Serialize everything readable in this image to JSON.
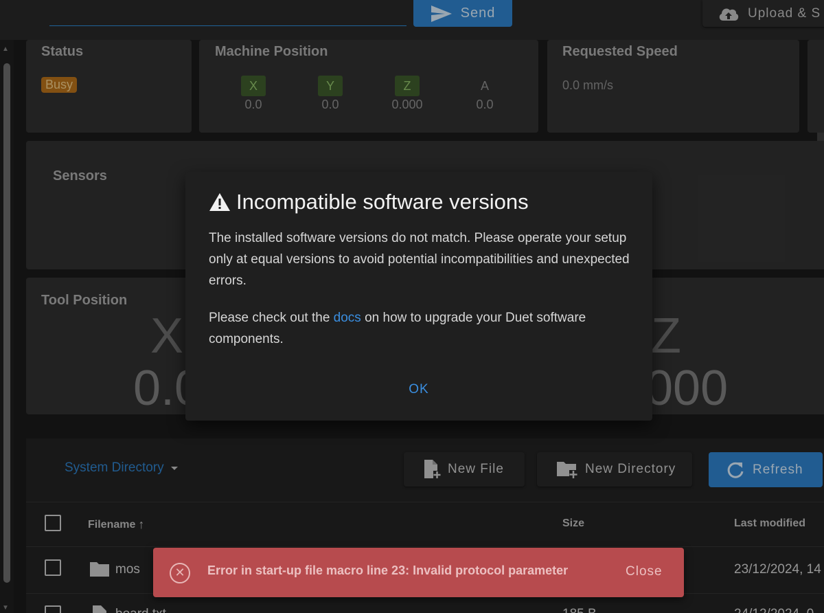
{
  "topbar": {
    "send_label": "Send",
    "upload_label": "Upload & S"
  },
  "status_card": {
    "title": "Status",
    "badge": "Busy"
  },
  "machine_position": {
    "title": "Machine Position",
    "axes": [
      {
        "label": "X",
        "value": "0.0"
      },
      {
        "label": "Y",
        "value": "0.0"
      },
      {
        "label": "Z",
        "value": "0.000"
      },
      {
        "label": "A",
        "value": "0.0"
      }
    ]
  },
  "requested_speed": {
    "title": "Requested Speed",
    "value": "0.0 mm/s"
  },
  "sensors": {
    "title": "Sensors"
  },
  "tool_position": {
    "title": "Tool Position",
    "x_label": "X",
    "x_value": "0.0",
    "z_label": "Z",
    "z_value": "000"
  },
  "file_panel": {
    "directory": "System Directory",
    "new_file": "New File",
    "new_directory": "New Directory",
    "refresh": "Refresh",
    "columns": {
      "filename": "Filename",
      "size": "Size",
      "last_modified": "Last modified"
    },
    "rows": [
      {
        "name": "mos",
        "size": "",
        "modified": "23/12/2024, 14"
      },
      {
        "name": "board.txt",
        "size": "185 B",
        "modified": "24/12/2024, 0"
      }
    ]
  },
  "dialog": {
    "title": "Incompatible software versions",
    "paragraph1": "The installed software versions do not match. Please operate your setup only at equal versions to avoid potential incompatibilities and unexpected errors.",
    "paragraph2_before": "Please check out the ",
    "paragraph2_link": "docs",
    "paragraph2_after": " on how to upgrade your Duet software components.",
    "ok_label": "OK"
  },
  "snackbar": {
    "message": "Error in start-up file macro line 23: Invalid protocol parameter",
    "close_label": "Close"
  },
  "colors": {
    "accent": "#2f80c9",
    "busy": "#b5701a",
    "error": "#b74b4e"
  }
}
